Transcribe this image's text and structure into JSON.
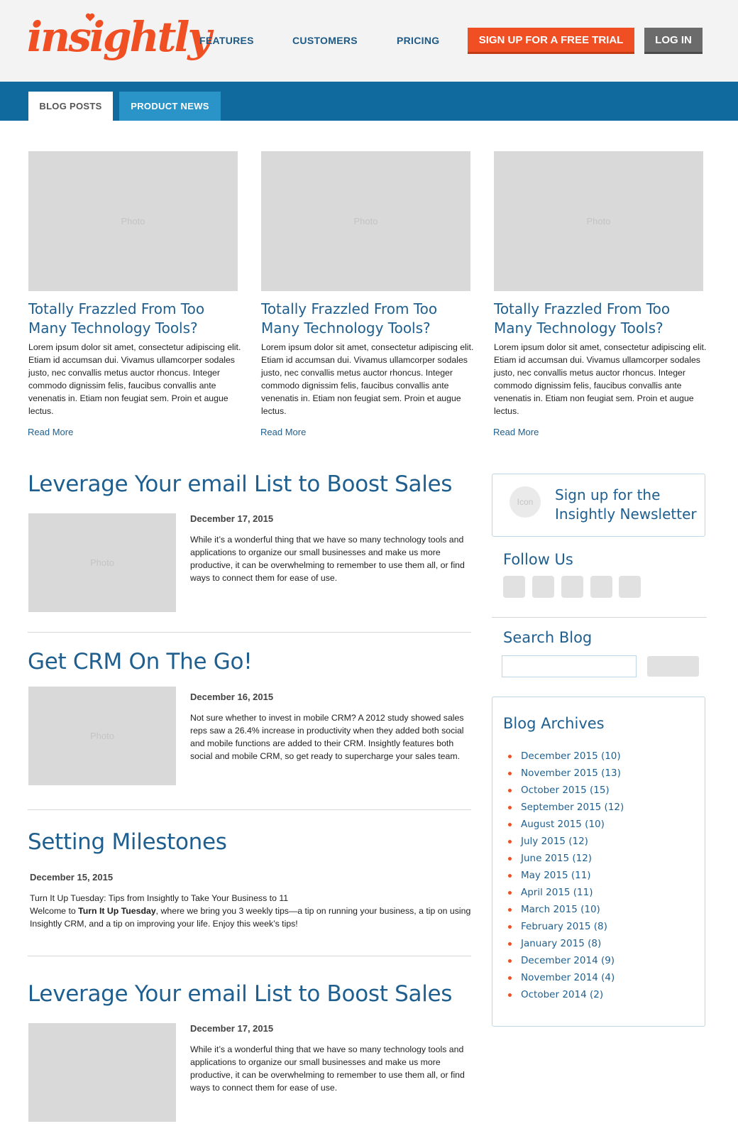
{
  "header": {
    "logo_text": "insightly",
    "nav": [
      "FEATURES",
      "CUSTOMERS",
      "PRICING"
    ],
    "cta_label": "SIGN UP FOR A FREE TRIAL",
    "login_label": "LOG IN"
  },
  "tabs": [
    {
      "label": "BLOG POSTS",
      "active": true
    },
    {
      "label": "PRODUCT NEWS",
      "active": false
    }
  ],
  "photo_placeholder": "Photo",
  "cards": [
    {
      "title": "Totally Frazzled From Too Many Technology Tools?",
      "excerpt": "Lorem ipsum dolor sit amet, consectetur adipiscing elit. Etiam id accumsan dui. Vivamus ullamcorper sodales justo, nec convallis metus auctor rhoncus. Integer commodo dignissim felis, faucibus convallis ante venenatis in. Etiam non feugiat sem. Proin et augue lectus.",
      "read_more": "Read More"
    },
    {
      "title": "Totally Frazzled From Too Many Technology Tools?",
      "excerpt": "Lorem ipsum dolor sit amet, consectetur adipiscing elit. Etiam id accumsan dui. Vivamus ullamcorper sodales justo, nec convallis metus auctor rhoncus. Integer commodo dignissim felis, faucibus convallis ante venenatis in. Etiam non feugiat sem. Proin et augue lectus.",
      "read_more": "Read More"
    },
    {
      "title": "Totally Frazzled From Too Many Technology Tools?",
      "excerpt": "Lorem ipsum dolor sit amet, consectetur adipiscing elit. Etiam id accumsan dui. Vivamus ullamcorper sodales justo, nec convallis metus auctor rhoncus. Integer commodo dignissim felis, faucibus convallis ante venenatis in. Etiam non feugiat sem. Proin et augue lectus.",
      "read_more": "Read More"
    }
  ],
  "posts": [
    {
      "title": "Leverage Your email List to Boost Sales",
      "date": "December 17, 2015",
      "text": "While it’s a wonderful thing that we have so many technology tools and applications to organize our small businesses and make us more productive, it can be overwhelming to remember to use them all, or find ways to connect them for ease of use."
    },
    {
      "title": "Get CRM On The Go!",
      "date": "December 16, 2015",
      "text": "Not sure whether to invest in mobile CRM? A 2012 study showed sales reps saw a 26.4% increase in productivity when they added both social and mobile functions are added to their CRM. Insightly features both social and mobile CRM, so get ready to supercharge your sales team."
    },
    {
      "title": "Setting Milestones",
      "date": "December 15, 2015",
      "line1": "Turn It Up Tuesday: Tips from Insightly to Take Your Business to 11",
      "line2_pre": "Welcome to ",
      "line2_bold": "Turn It Up Tuesday",
      "line2_post": ", where we bring you 3 weekly tips—a tip on running your business, a tip on using Insightly CRM, and a tip on improving your life. Enjoy this week’s tips!"
    },
    {
      "title": "Leverage Your email List to Boost Sales",
      "date": "December 17, 2015",
      "text": "While it’s a wonderful thing that we have so many technology tools and applications to organize our small businesses and make us more productive, it can be overwhelming to remember to use them all, or find ways to connect them for ease of use."
    }
  ],
  "sidebar": {
    "newsletter_icon": "Icon",
    "newsletter_text": "Sign up for the Insightly Newsletter",
    "follow_heading": "Follow Us",
    "search_heading": "Search Blog",
    "search_value": "",
    "archives_heading": "Blog Archives",
    "archives": [
      "December 2015 (10)",
      "November 2015 (13)",
      "October 2015 (15)",
      "September 2015 (12)",
      "August 2015 (10)",
      "July 2015 (12)",
      "June 2015 (12)",
      "May 2015 (11)",
      "April 2015 (11)",
      "March 2015 (10)",
      "February 2015 (8)",
      "January 2015 (8)",
      "December 2014 (9)",
      "November 2014 (4)",
      "October 2014 (2)"
    ]
  },
  "colors": {
    "brand_orange": "#f04e23",
    "brand_blue": "#116a9e",
    "link_blue": "#1f5f8f"
  }
}
